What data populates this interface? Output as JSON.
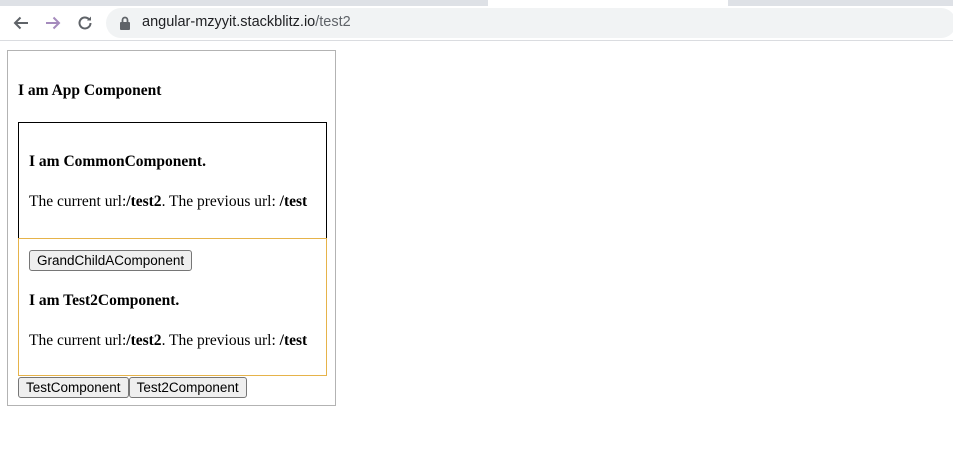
{
  "browser": {
    "url_host": "angular-mzyyit.stackblitz.io",
    "url_path": "/test2",
    "icons": [
      "back-arrow-icon",
      "forward-arrow-icon",
      "reload-icon",
      "lock-icon"
    ]
  },
  "app": {
    "title": "I am App Component",
    "common": {
      "title": "I am CommonComponent.",
      "url_prefix": "The current url:",
      "current_url": "/test2",
      "url_middle": ". The previous url: ",
      "previous_url": "/test"
    },
    "child": {
      "grandchild_button": "GrandChildAComponent",
      "title": "I am Test2Component.",
      "url_prefix": "The current url:",
      "current_url": "/test2",
      "url_middle": ". The previous url: ",
      "previous_url": "/test"
    },
    "buttons": {
      "test": "TestComponent",
      "test2": "Test2Component"
    }
  }
}
